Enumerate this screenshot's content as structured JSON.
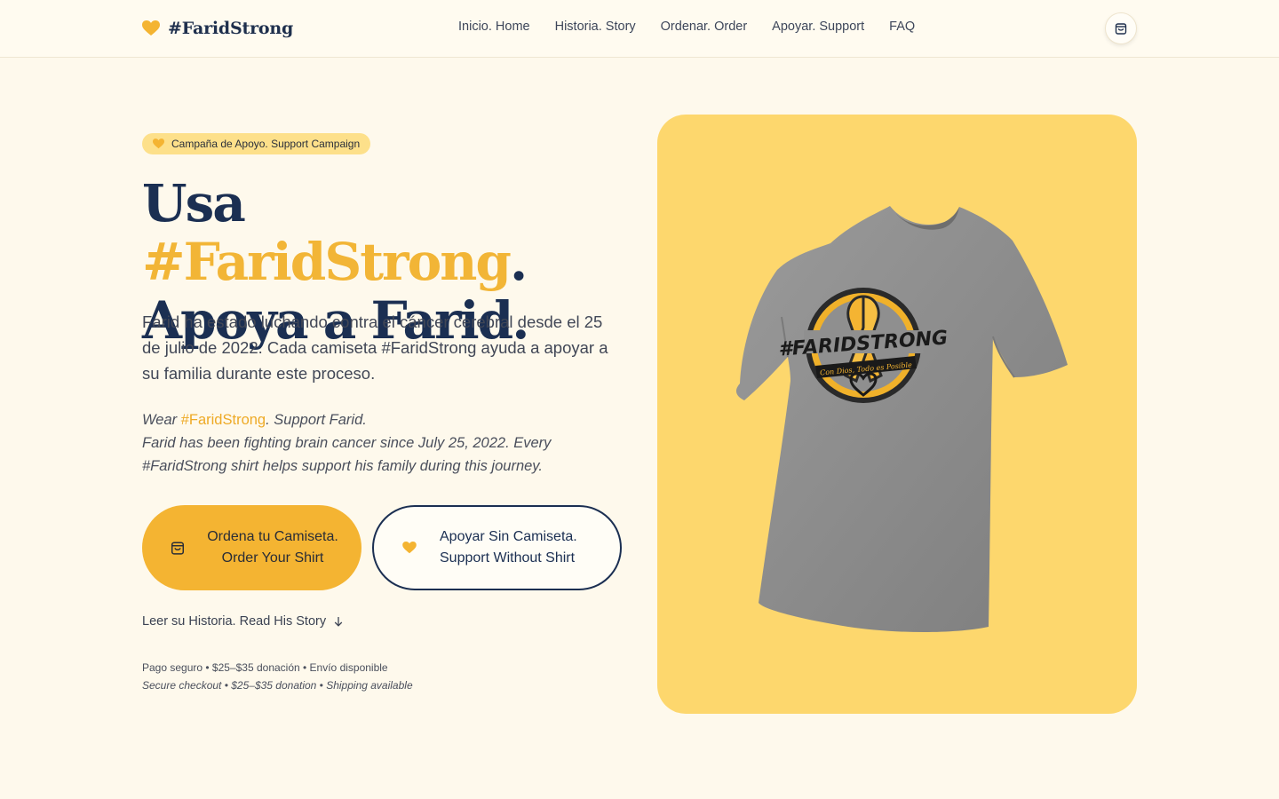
{
  "header": {
    "brand": "#FaridStrong",
    "nav": [
      "Inicio. Home",
      "Historia. Story",
      "Ordenar. Order",
      "Apoyar. Support",
      "FAQ"
    ],
    "cart_icon": "shopping-bag-icon"
  },
  "hero": {
    "badge": "Campaña de Apoyo. Support Campaign",
    "headline": {
      "word1": "Usa ",
      "accent": "#FaridStrong",
      "period": ".",
      "line2": "Apoya a Farid."
    },
    "lead_es": "Farid ha estado luchando contra el cáncer cerebral desde el 25 de julio de 2022. Cada camiseta #FaridStrong ayuda a apoyar a su familia durante este proceso.",
    "lead_en": {
      "wear": "Wear ",
      "tag": "#FaridStrong",
      "rest": ". Support Farid.",
      "line2": "Farid has been fighting brain cancer since July 25, 2022. Every #FaridStrong shirt helps support his family during this journey."
    },
    "btn_order": "Ordena tu Camiseta. Order Your Shirt",
    "btn_support_line1": "Apoyar Sin Camiseta.",
    "btn_support_line2": "Support Without Shirt",
    "story_link": "Leer su Historia. Read His Story",
    "fine_es": "Pago seguro • $25–$35 donación • Envío disponible",
    "fine_en": "Secure checkout • $25–$35 donation • Shipping available"
  },
  "product": {
    "shirt_text": "#FARIDSTRONG",
    "shirt_subtext": "Con Dios, Todo es Posible"
  },
  "colors": {
    "accent": "#f4b432",
    "navy": "#1b2f52",
    "background": "#fef9ec",
    "card": "#fdd76d"
  }
}
